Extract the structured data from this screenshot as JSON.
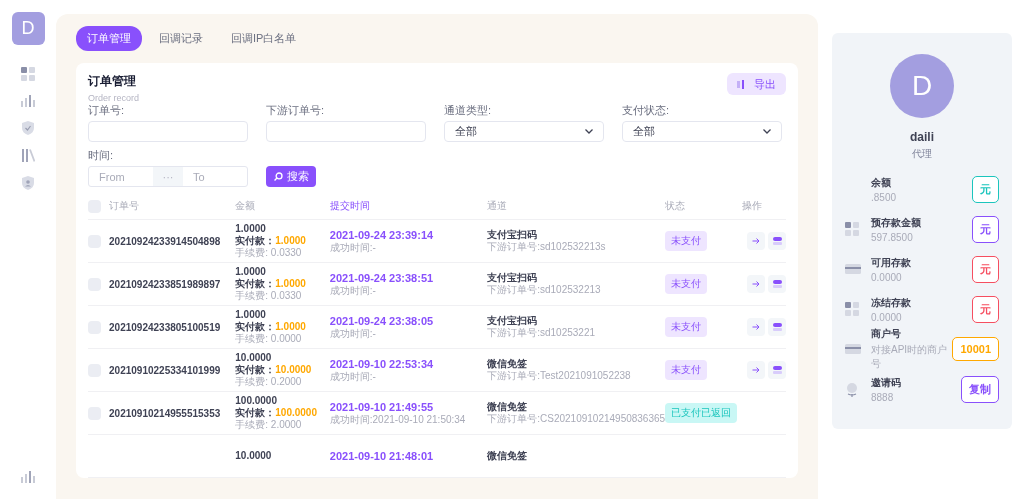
{
  "sidebar": {
    "avatar": "D"
  },
  "tabs": [
    {
      "label": "订单管理",
      "selected": true
    },
    {
      "label": "回调记录",
      "selected": false
    },
    {
      "label": "回调IP白名单",
      "selected": false
    }
  ],
  "card": {
    "title": "订单管理",
    "subtitle": "Order record",
    "export_button": "导出"
  },
  "filters": {
    "order_no": {
      "label": "订单号:"
    },
    "downstream_no": {
      "label": "下游订单号:"
    },
    "channel_type": {
      "label": "通道类型:",
      "value": "全部"
    },
    "pay_status": {
      "label": "支付状态:",
      "value": "全部"
    },
    "time": {
      "label": "时间:",
      "from_placeholder": "From",
      "separator": "···",
      "to_placeholder": "To"
    },
    "search_button": "搜索"
  },
  "table": {
    "select_all": {
      "checked": false
    },
    "columns": [
      "订单号",
      "金额",
      "提交时间",
      "通道",
      "状态",
      "操作"
    ],
    "rows": [
      {
        "checked": false,
        "order_no": "20210924233914504898",
        "amount": "1.0000",
        "paid_label": "实付款：",
        "paid": "1.0000",
        "fee": "手续费: 0.0330",
        "submit_time": "2021-09-24 23:39:14",
        "success_time": "成功时间:-",
        "channel": "支付宝扫码",
        "downstream": "下游订单号:sd102532213s",
        "status": {
          "text": "未支付",
          "kind": "unpaid"
        },
        "actions": true
      },
      {
        "checked": false,
        "order_no": "20210924233851989897",
        "amount": "1.0000",
        "paid_label": "实付款：",
        "paid": "1.0000",
        "fee": "手续费: 0.0330",
        "submit_time": "2021-09-24 23:38:51",
        "success_time": "成功时间:-",
        "channel": "支付宝扫码",
        "downstream": "下游订单号:sd102532213",
        "status": {
          "text": "未支付",
          "kind": "unpaid"
        },
        "actions": true
      },
      {
        "checked": false,
        "order_no": "20210924233805100519",
        "amount": "1.0000",
        "paid_label": "实付款：",
        "paid": "1.0000",
        "fee": "手续费: 0.0000",
        "submit_time": "2021-09-24 23:38:05",
        "success_time": "成功时间:-",
        "channel": "支付宝扫码",
        "downstream": "下游订单号:sd10253221",
        "status": {
          "text": "未支付",
          "kind": "unpaid"
        },
        "actions": true
      },
      {
        "checked": false,
        "order_no": "20210910225334101999",
        "amount": "10.0000",
        "paid_label": "实付款：",
        "paid": "10.0000",
        "fee": "手续费: 0.2000",
        "submit_time": "2021-09-10 22:53:34",
        "success_time": "成功时间:-",
        "channel": "微信免签",
        "downstream": "下游订单号:Test2021091052238",
        "status": {
          "text": "未支付",
          "kind": "unpaid"
        },
        "actions": true
      },
      {
        "checked": false,
        "order_no": "20210910214955515353",
        "amount": "100.0000",
        "paid_label": "实付款：",
        "paid": "100.0000",
        "fee": "手续费: 2.0000",
        "submit_time": "2021-09-10 21:49:55",
        "success_time": "成功时间:2021-09-10 21:50:34",
        "channel": "微信免签",
        "downstream": "下游订单号:CS20210910214950836365",
        "status": {
          "text": "已支付已返回",
          "kind": "paid"
        },
        "actions": false
      },
      {
        "amount": "10.0000",
        "submit_time": "2021-09-10 21:48:01",
        "channel": "微信免签"
      }
    ]
  },
  "profile": {
    "avatar": "D",
    "name": "daili",
    "role": "代理",
    "items": [
      {
        "label": "余额",
        "value": ".8500",
        "badge": "元",
        "color": "#1bc5bd"
      },
      {
        "label": "预存款金额",
        "value": "597.8500",
        "badge": "元",
        "color": "#8950fc"
      },
      {
        "label": "可用存款",
        "value": "0.0000",
        "badge": "元",
        "color": "#f64e60"
      },
      {
        "label": "冻结存款",
        "value": "0.0000",
        "badge": "元",
        "color": "#f64e60"
      },
      {
        "label": "商户号",
        "value": "对接API时的商户号",
        "badge": "10001",
        "color": "#ffa800"
      },
      {
        "label": "邀请码",
        "value": "8888",
        "badge": "复制",
        "color": "#8950fc"
      }
    ]
  }
}
